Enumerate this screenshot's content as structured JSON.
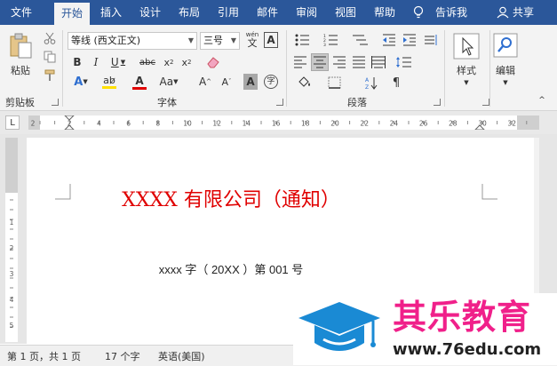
{
  "tabs": [
    "文件",
    "开始",
    "插入",
    "设计",
    "布局",
    "引用",
    "邮件",
    "审阅",
    "视图",
    "帮助"
  ],
  "tell_me": "告诉我",
  "share": "共享",
  "clipboard": {
    "paste": "粘贴",
    "label": "剪贴板"
  },
  "font": {
    "name": "等线 (西文正文)",
    "size": "三号",
    "wen": "wén",
    "wen_char": "文",
    "a_char": "A",
    "label": "字体",
    "accent_red": "#e00000",
    "highlight": "#ffe000"
  },
  "paragraph": {
    "label": "段落"
  },
  "styles": {
    "label": "样式"
  },
  "editing": {
    "label": "编辑"
  },
  "ruler_numbers": [
    "2",
    "2",
    "4",
    "6",
    "8",
    "10",
    "12",
    "14",
    "16",
    "18",
    "20",
    "22",
    "24",
    "26",
    "28",
    "30",
    "32"
  ],
  "vruler_numbers": [
    "1",
    "2",
    "3",
    "4",
    "5",
    "6"
  ],
  "doc": {
    "title": "XXXX 有限公司（通知）",
    "title_color": "#e00000",
    "doc_number": "xxxx 字（ 20XX ）第 001 号"
  },
  "status": {
    "page": "第 1 页，共 1 页",
    "words": "17 个字",
    "language": "英语(美国)"
  },
  "watermark": {
    "name": "其乐教育",
    "url": "www.76edu.com",
    "name_color": "#f0208a",
    "cap_color": "#1a8ad4"
  }
}
